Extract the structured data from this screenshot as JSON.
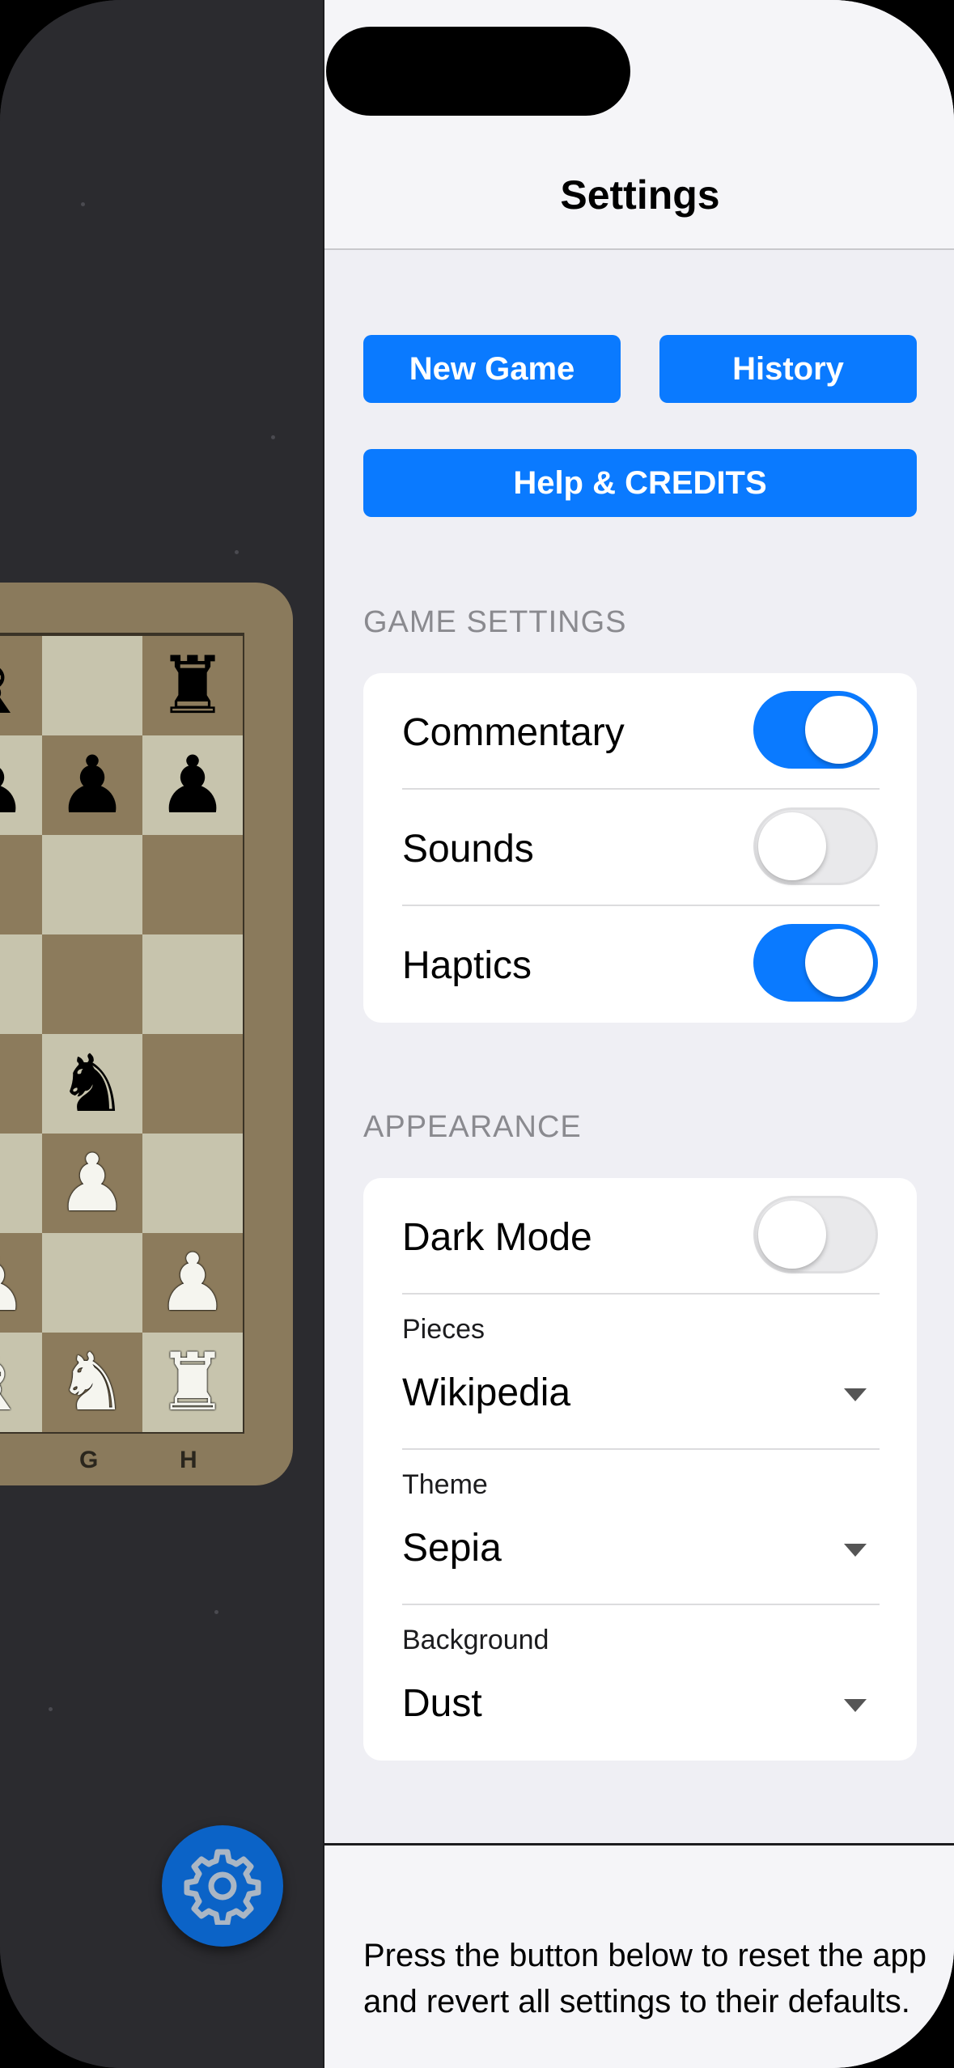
{
  "settings": {
    "title": "Settings",
    "buttons": {
      "new_game": "New Game",
      "history": "History",
      "help": "Help & CREDITS"
    },
    "game_settings": {
      "header": "GAME SETTINGS",
      "items": [
        {
          "label": "Commentary",
          "enabled": true
        },
        {
          "label": "Sounds",
          "enabled": false
        },
        {
          "label": "Haptics",
          "enabled": true
        }
      ]
    },
    "appearance": {
      "header": "APPEARANCE",
      "dark_mode": {
        "label": "Dark Mode",
        "enabled": false
      },
      "pieces": {
        "label": "Pieces",
        "value": "Wikipedia"
      },
      "theme": {
        "label": "Theme",
        "value": "Sepia"
      },
      "background": {
        "label": "Background",
        "value": "Dust"
      }
    },
    "footer_text": "Press the button below to reset the app and revert all settings to their defaults."
  },
  "board": {
    "file_labels": [
      "G",
      "H"
    ],
    "icons": {
      "settings": "gear-icon"
    }
  },
  "colors": {
    "accent": "#0a7aff",
    "gear_button": "#0b63c7",
    "board_light": "#c7c4ad",
    "board_dark": "#8c7b5c"
  }
}
